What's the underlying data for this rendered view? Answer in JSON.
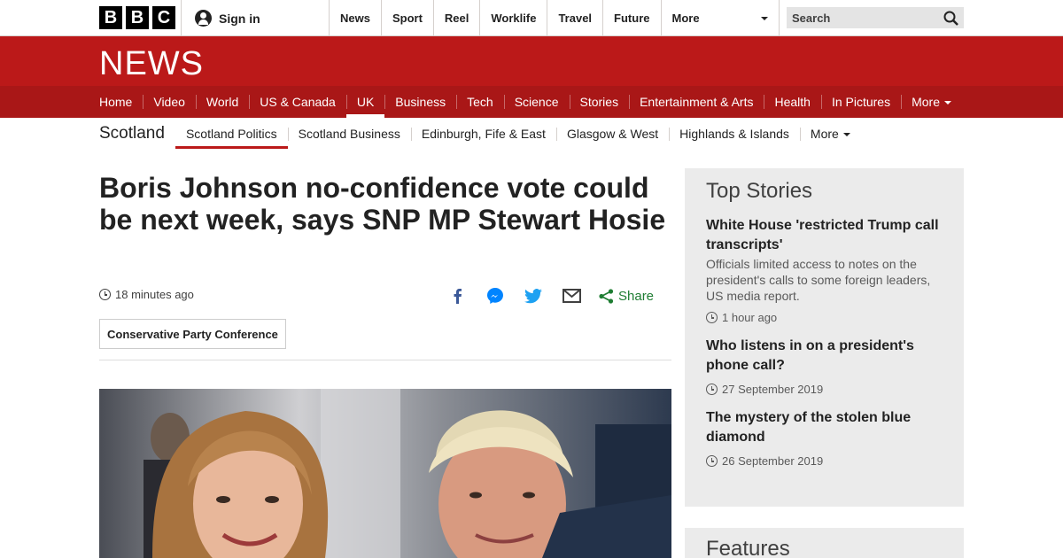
{
  "topbar": {
    "logo_letters": [
      "B",
      "B",
      "C"
    ],
    "sign_in": "Sign in",
    "nav": [
      "News",
      "Sport",
      "Reel",
      "Worklife",
      "Travel",
      "Future"
    ],
    "more": "More",
    "search_placeholder": "Search"
  },
  "banner": {
    "title": "NEWS"
  },
  "section_nav": {
    "items": [
      "Home",
      "Video",
      "World",
      "US & Canada",
      "UK",
      "Business",
      "Tech",
      "Science",
      "Stories",
      "Entertainment & Arts",
      "Health",
      "In Pictures"
    ],
    "active": "UK",
    "more": "More"
  },
  "sub_nav": {
    "region": "Scotland",
    "items": [
      "Scotland Politics",
      "Scotland Business",
      "Edinburgh, Fife & East",
      "Glasgow & West",
      "Highlands & Islands"
    ],
    "active": "Scotland Politics",
    "more": "More"
  },
  "article": {
    "headline": "Boris Johnson no-confidence vote could be next week, says SNP MP Stewart Hosie",
    "timestamp": "18 minutes ago",
    "share_label": "Share",
    "tag": "Conservative Party Conference"
  },
  "sidebar": {
    "heading": "Top Stories",
    "stories": [
      {
        "title": "White House 'restricted Trump call transcripts'",
        "summary": "Officials limited access to notes on the president's calls to some foreign leaders, US media report.",
        "time": "1 hour ago"
      },
      {
        "title": "Who listens in on a president's phone call?",
        "summary": "",
        "time": "27 September 2019"
      },
      {
        "title": "The mystery of the stolen blue diamond",
        "summary": "",
        "time": "26 September 2019"
      }
    ],
    "features_heading": "Features"
  },
  "colors": {
    "brand_red": "#bb1919",
    "section_red": "#a91717",
    "share_green": "#1f7d33",
    "facebook": "#3b5998",
    "messenger": "#0084ff",
    "twitter": "#1da1f2"
  }
}
